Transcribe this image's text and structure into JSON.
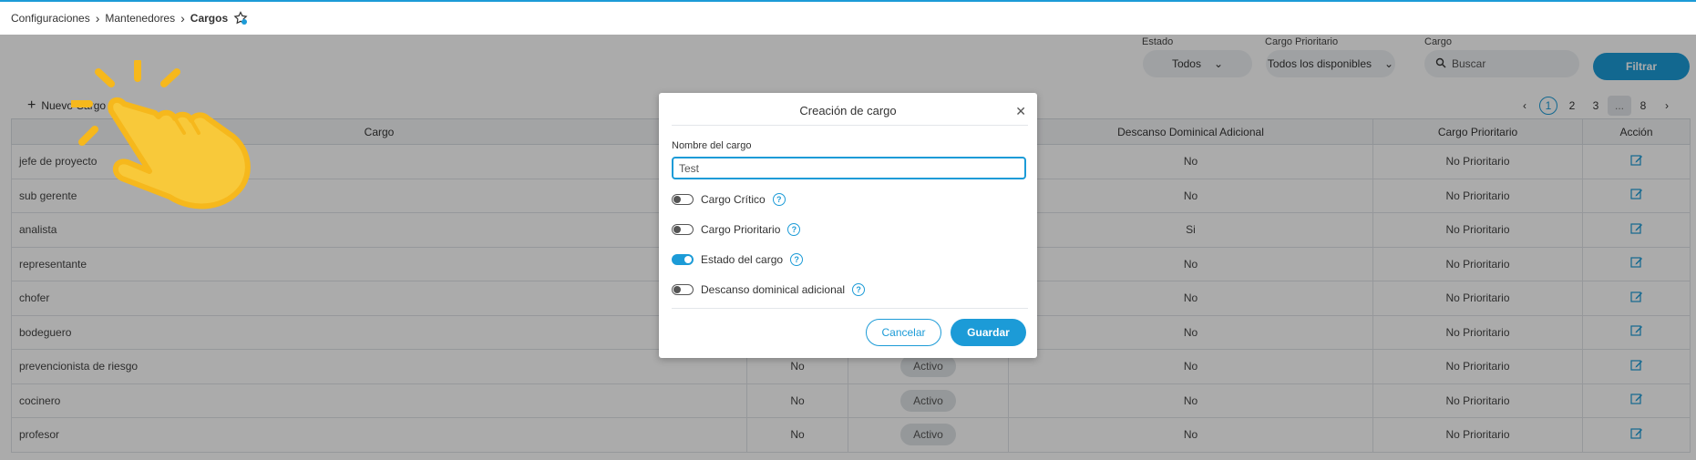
{
  "breadcrumb": {
    "items": [
      "Configuraciones",
      "Mantenedores",
      "Cargos"
    ]
  },
  "filters": {
    "estado": {
      "label": "Estado",
      "value": "Todos"
    },
    "prioritario": {
      "label": "Cargo Prioritario",
      "value": "Todos los disponibles"
    },
    "cargo": {
      "label": "Cargo",
      "placeholder": "Buscar"
    },
    "button": "Filtrar"
  },
  "new_button": "Nuevo Cargo",
  "pagination": {
    "pages": [
      "1",
      "2",
      "3",
      "...",
      "8"
    ],
    "current": "1"
  },
  "table": {
    "headers": [
      "Cargo",
      "",
      "",
      "Descanso Dominical Adicional",
      "Cargo Prioritario",
      "Acción"
    ],
    "rows": [
      [
        "jefe de proyecto",
        "",
        "",
        "No",
        "No Prioritario"
      ],
      [
        "sub gerente",
        "",
        "",
        "No",
        "No Prioritario"
      ],
      [
        "analista",
        "",
        "",
        "Si",
        "No Prioritario"
      ],
      [
        "representante",
        "",
        "",
        "No",
        "No Prioritario"
      ],
      [
        "chofer",
        "",
        "",
        "No",
        "No Prioritario"
      ],
      [
        "bodeguero",
        "",
        "",
        "No",
        "No Prioritario"
      ],
      [
        "prevencionista de riesgo",
        "No",
        "Activo",
        "No",
        "No Prioritario"
      ],
      [
        "cocinero",
        "No",
        "Activo",
        "No",
        "No Prioritario"
      ],
      [
        "profesor",
        "No",
        "Activo",
        "No",
        "No Prioritario"
      ]
    ]
  },
  "modal": {
    "title": "Creación de cargo",
    "field_label": "Nombre del cargo",
    "field_value": "Test",
    "toggles": [
      {
        "label": "Cargo Crítico",
        "on": false
      },
      {
        "label": "Cargo Prioritario",
        "on": false
      },
      {
        "label": "Estado del cargo",
        "on": true
      },
      {
        "label": "Descanso dominical adicional",
        "on": false
      }
    ],
    "cancel": "Cancelar",
    "save": "Guardar"
  },
  "colors": {
    "accent": "#1c9bd7",
    "overlay": "rgba(0,0,0,0.33)",
    "hand": "#f6c02e"
  }
}
